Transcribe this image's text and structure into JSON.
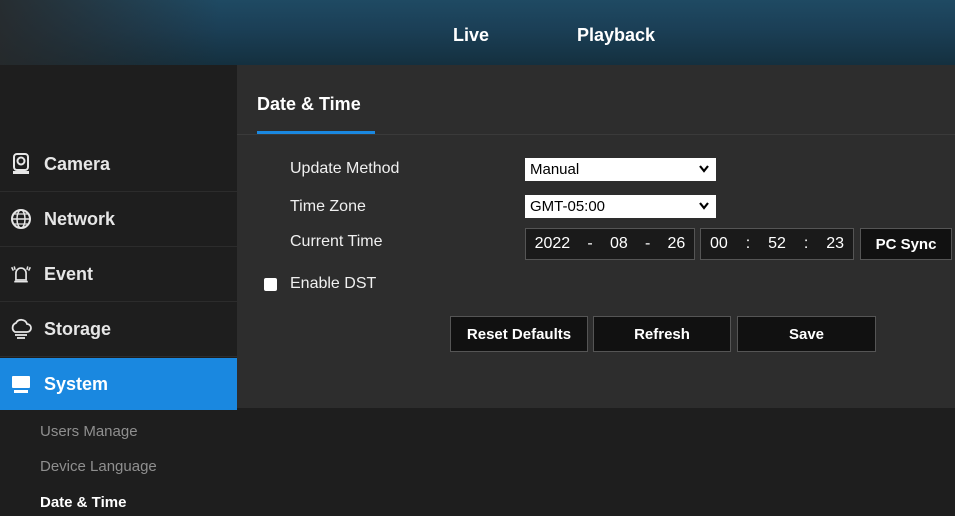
{
  "nav": {
    "live": "Live",
    "playback": "Playback"
  },
  "sidebar": {
    "items": [
      {
        "label": "Camera",
        "icon": "camera-icon"
      },
      {
        "label": "Network",
        "icon": "network-icon"
      },
      {
        "label": "Event",
        "icon": "event-icon"
      },
      {
        "label": "Storage",
        "icon": "storage-icon"
      },
      {
        "label": "System",
        "icon": "system-icon",
        "active": true
      }
    ],
    "subitems": [
      "Users Manage",
      "Device Language",
      "Date & Time"
    ],
    "current_subitem": "Date & Time"
  },
  "page": {
    "title": "Date & Time",
    "update_method": {
      "label": "Update Method",
      "value": "Manual"
    },
    "time_zone": {
      "label": "Time Zone",
      "value": "GMT-05:00"
    },
    "current_time": {
      "label": "Current Time",
      "year": "2022",
      "month": "08",
      "day": "26",
      "hour": "00",
      "minute": "52",
      "second": "23",
      "date_sep": "-",
      "time_sep": ":"
    },
    "pc_sync": "PC Sync",
    "enable_dst": {
      "label": "Enable DST",
      "checked": false
    },
    "buttons": {
      "reset": "Reset Defaults",
      "refresh": "Refresh",
      "save": "Save"
    }
  },
  "colors": {
    "accent": "#1a88e0",
    "topbar": "#1b3f56",
    "panel": "#2d2d2d",
    "sidebar": "#1e1e1e"
  }
}
